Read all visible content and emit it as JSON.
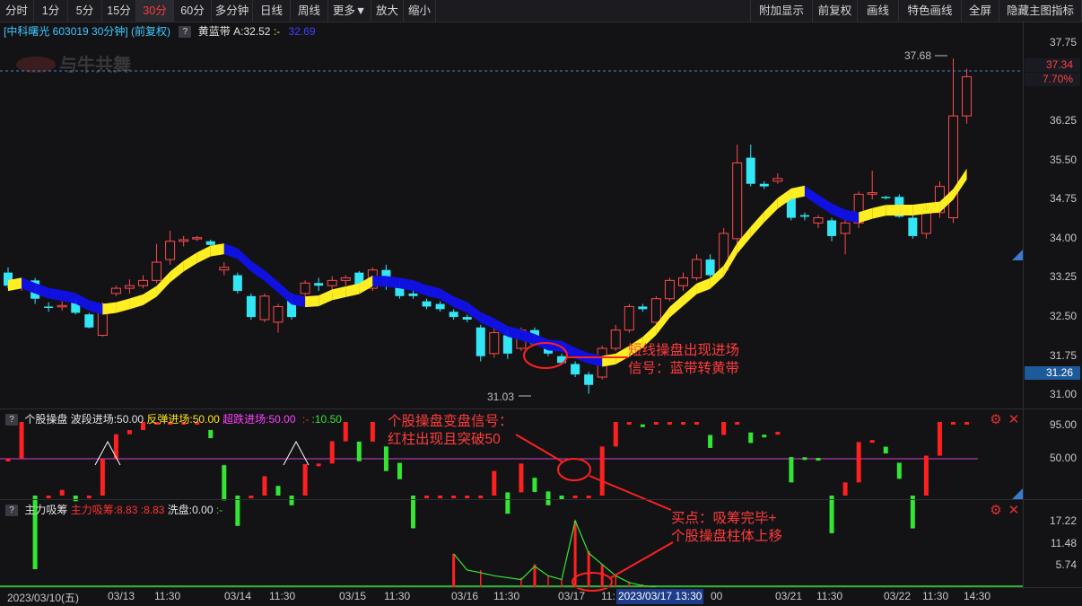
{
  "toolbar": {
    "left": [
      "分时",
      "1分",
      "5分",
      "15分",
      "30分",
      "60分",
      "多分钟",
      "日线",
      "周线",
      "更多▼",
      "放大",
      "缩小"
    ],
    "active": "30分",
    "right": [
      "附加显示",
      "前复权",
      "画线",
      "特色画线",
      "全屏",
      "隐藏主图指标"
    ]
  },
  "main_panel": {
    "stock_label": "[中科曙光 603019 30分钟] (前复权)",
    "indicator_name": "黄蓝带",
    "indicator_value": "A:32.52",
    "indicator_sep": ":-",
    "indicator_value2": "32.69",
    "watermark": "与牛共舞",
    "high_label": "37.68",
    "low_label": "31.03",
    "current_price": "37.34",
    "current_pct": "7.70%",
    "cursor_price": "31.26",
    "price_axis": [
      "37.75",
      "37.00",
      "36.25",
      "35.50",
      "34.75",
      "34.00",
      "33.25",
      "32.50",
      "31.75",
      "31.00"
    ]
  },
  "osc_panel": {
    "name": "个股操盘",
    "l1": "波段进场:50.00",
    "l2": "反弹进场:50.00",
    "l3": "超跌进场:50.00",
    "l4": ":-",
    "l5": ":10.50",
    "axis": [
      "95.00",
      "50.00"
    ]
  },
  "vol_panel": {
    "name": "主力吸筹",
    "l1": "主力吸筹:8.83",
    "l2": ":8.83",
    "l3": "洗盘:0.00",
    "l4": ":-",
    "axis": [
      "17.22",
      "11.48",
      "5.74"
    ]
  },
  "x_axis": {
    "labels": [
      "2023/03/10(五)",
      "03/13",
      "11:30",
      "03/14",
      "11:30",
      "03/15",
      "11:30",
      "03/16",
      "11:30",
      "03/17",
      "11:",
      "03/21",
      "11:30",
      "03/22",
      "11:30",
      "14:30"
    ],
    "cursor_label": "2023/03/17 13:30",
    "tail": "00"
  },
  "annotations": {
    "a1": [
      "短线操盘出现进场",
      "信号：蓝带转黄带"
    ],
    "a2": [
      "个股操盘变盘信号：",
      "红柱出现且突破50"
    ],
    "a3": [
      "买点：吸筹完毕+",
      "个股操盘柱体上移"
    ]
  },
  "colors": {
    "up": "#ff4a4a",
    "down": "#33e6f6",
    "yellow_band": "#ffee22",
    "blue_band": "#1010e0",
    "green": "#33e633",
    "magenta_line": "#d040d0"
  },
  "chart_data": {
    "type": "candlestick",
    "x": [
      "03/10 10:00",
      "03/10 10:30",
      "03/10 11:00",
      "03/10 11:30",
      "03/10 13:30",
      "03/10 14:00",
      "03/10 14:30",
      "03/10 15:00",
      "03/13 10:00",
      "03/13 10:30",
      "03/13 11:00",
      "03/13 11:30",
      "03/13 13:30",
      "03/13 14:00",
      "03/13 14:30",
      "03/13 15:00",
      "03/14 10:00",
      "03/14 10:30",
      "03/14 11:00",
      "03/14 11:30",
      "03/14 13:30",
      "03/14 14:00",
      "03/14 14:30",
      "03/14 15:00",
      "03/15 10:00",
      "03/15 10:30",
      "03/15 11:00",
      "03/15 11:30",
      "03/15 13:30",
      "03/15 14:00",
      "03/15 14:30",
      "03/15 15:00",
      "03/16 10:00",
      "03/16 10:30",
      "03/16 11:00",
      "03/16 11:30",
      "03/16 13:30",
      "03/16 14:00",
      "03/16 14:30",
      "03/16 15:00",
      "03/17 10:00",
      "03/17 10:30",
      "03/17 11:00",
      "03/17 11:30",
      "03/17 13:30",
      "03/17 14:00",
      "03/17 14:30",
      "03/17 15:00",
      "03/20 10:00",
      "03/20 10:30",
      "03/20 11:00",
      "03/20 11:30",
      "03/20 13:30",
      "03/20 14:00",
      "03/20 14:30",
      "03/20 15:00",
      "03/21 10:00",
      "03/21 10:30",
      "03/21 11:00",
      "03/21 11:30",
      "03/21 13:30",
      "03/21 14:00",
      "03/21 14:30",
      "03/21 15:00",
      "03/22 10:00",
      "03/22 10:30",
      "03/22 11:00",
      "03/22 11:30",
      "03/22 13:30",
      "03/22 14:00",
      "03/22 14:30",
      "03/22 15:00"
    ],
    "ohlc": [
      [
        33.35,
        33.45,
        33.05,
        33.1
      ],
      [
        33.1,
        33.25,
        33.0,
        33.2
      ],
      [
        33.2,
        33.25,
        32.75,
        32.85
      ],
      [
        32.7,
        32.78,
        32.6,
        32.68
      ],
      [
        32.7,
        32.8,
        32.62,
        32.72
      ],
      [
        32.78,
        32.85,
        32.55,
        32.58
      ],
      [
        32.55,
        32.58,
        32.28,
        32.3
      ],
      [
        32.15,
        32.78,
        32.12,
        32.75
      ],
      [
        32.95,
        33.1,
        32.9,
        33.05
      ],
      [
        33.05,
        33.22,
        32.95,
        33.1
      ],
      [
        33.1,
        33.3,
        33.05,
        33.2
      ],
      [
        33.2,
        33.9,
        33.15,
        33.55
      ],
      [
        33.6,
        34.15,
        33.5,
        33.95
      ],
      [
        33.95,
        34.05,
        33.85,
        33.98
      ],
      [
        34.0,
        34.05,
        33.95,
        34.02
      ],
      [
        33.95,
        33.98,
        33.85,
        33.88
      ],
      [
        33.4,
        33.55,
        33.3,
        33.45
      ],
      [
        33.3,
        33.35,
        32.95,
        33.0
      ],
      [
        32.9,
        32.95,
        32.45,
        32.5
      ],
      [
        32.45,
        32.95,
        32.4,
        32.9
      ],
      [
        32.4,
        32.75,
        32.2,
        32.7
      ],
      [
        32.9,
        32.95,
        32.45,
        32.5
      ],
      [
        32.95,
        33.2,
        32.9,
        33.15
      ],
      [
        33.15,
        33.25,
        33.0,
        33.1
      ],
      [
        33.1,
        33.28,
        32.95,
        33.2
      ],
      [
        33.2,
        33.3,
        33.1,
        33.25
      ],
      [
        33.35,
        33.38,
        33.0,
        33.05
      ],
      [
        33.05,
        33.45,
        33.0,
        33.4
      ],
      [
        33.4,
        33.5,
        33.02,
        33.1
      ],
      [
        33.1,
        33.2,
        32.85,
        32.9
      ],
      [
        32.95,
        33.0,
        32.85,
        32.9
      ],
      [
        32.8,
        32.85,
        32.65,
        32.7
      ],
      [
        32.75,
        32.8,
        32.6,
        32.65
      ],
      [
        32.6,
        32.65,
        32.45,
        32.5
      ],
      [
        32.5,
        32.55,
        32.4,
        32.45
      ],
      [
        32.3,
        32.35,
        31.65,
        31.75
      ],
      [
        31.8,
        32.3,
        31.72,
        32.2
      ],
      [
        32.15,
        32.25,
        31.7,
        31.8
      ],
      [
        31.9,
        32.3,
        31.85,
        32.25
      ],
      [
        32.25,
        32.3,
        31.95,
        31.98
      ],
      [
        32.0,
        32.05,
        31.75,
        31.8
      ],
      [
        31.75,
        31.8,
        31.6,
        31.62
      ],
      [
        31.6,
        31.65,
        31.35,
        31.4
      ],
      [
        31.4,
        31.45,
        31.03,
        31.2
      ],
      [
        31.35,
        31.95,
        31.3,
        31.9
      ],
      [
        31.9,
        32.35,
        31.85,
        32.25
      ],
      [
        32.25,
        32.75,
        32.2,
        32.7
      ],
      [
        32.7,
        32.75,
        32.6,
        32.65
      ],
      [
        32.4,
        32.9,
        32.35,
        32.85
      ],
      [
        32.85,
        33.25,
        32.8,
        33.2
      ],
      [
        33.1,
        33.35,
        33.0,
        33.25
      ],
      [
        33.25,
        33.7,
        33.2,
        33.6
      ],
      [
        33.6,
        33.7,
        33.25,
        33.3
      ],
      [
        33.4,
        34.2,
        33.35,
        34.1
      ],
      [
        34.0,
        35.8,
        33.9,
        35.45
      ],
      [
        35.55,
        35.8,
        35.0,
        35.05
      ],
      [
        35.05,
        35.1,
        34.95,
        35.0
      ],
      [
        35.1,
        35.25,
        35.05,
        35.15
      ],
      [
        34.85,
        34.95,
        34.35,
        34.4
      ],
      [
        34.45,
        34.5,
        34.35,
        34.42
      ],
      [
        34.3,
        34.45,
        34.2,
        34.4
      ],
      [
        34.35,
        34.4,
        33.95,
        34.05
      ],
      [
        34.1,
        34.35,
        33.7,
        34.3
      ],
      [
        34.3,
        34.9,
        34.2,
        34.85
      ],
      [
        34.85,
        35.3,
        34.75,
        34.88
      ],
      [
        34.8,
        34.82,
        34.75,
        34.78
      ],
      [
        34.8,
        34.85,
        34.4,
        34.42
      ],
      [
        34.4,
        34.45,
        34.0,
        34.05
      ],
      [
        34.1,
        34.55,
        34.0,
        34.5
      ],
      [
        34.5,
        35.1,
        34.4,
        35.0
      ],
      [
        34.4,
        37.45,
        34.3,
        36.35
      ],
      [
        36.35,
        37.25,
        36.2,
        37.1
      ]
    ],
    "ylim": [
      31.0,
      37.8
    ]
  }
}
